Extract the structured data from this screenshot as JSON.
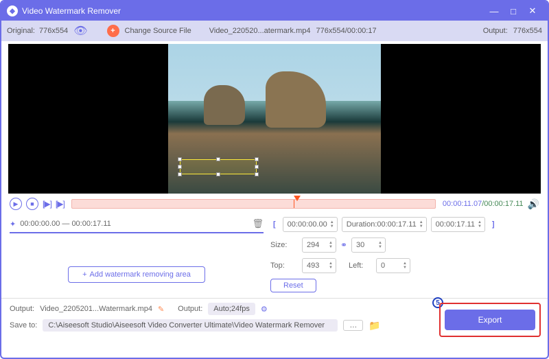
{
  "title": "Video Watermark Remover",
  "toolbar": {
    "original_label": "Original:",
    "original_dims": "776x554",
    "change_source": "Change Source File",
    "filename": "Video_220520...atermark.mp4",
    "file_info": "776x554/00:00:17",
    "output_label": "Output:",
    "output_dims": "776x554"
  },
  "controls": {
    "time_current": "00:00:11.07",
    "time_total": "/00:00:17.11"
  },
  "segment": {
    "range": "00:00:00.00 — 00:00:17.11"
  },
  "add_area_label": "Add watermark removing area",
  "range": {
    "start": "00:00:00.00",
    "duration_label": "Duration:",
    "duration": "00:00:17.11",
    "end": "00:00:17.11"
  },
  "size": {
    "label": "Size:",
    "w": "294",
    "h": "30"
  },
  "pos": {
    "top_label": "Top:",
    "top": "493",
    "left_label": "Left:",
    "left": "0"
  },
  "reset": "Reset",
  "output": {
    "label": "Output:",
    "filename": "Video_2205201...Watermark.mp4",
    "fmt_label": "Output:",
    "fmt": "Auto;24fps"
  },
  "save": {
    "label": "Save to:",
    "path": "C:\\Aiseesoft Studio\\Aiseesoft Video Converter Ultimate\\Video Watermark Remover"
  },
  "callout": "5",
  "export": "Export"
}
